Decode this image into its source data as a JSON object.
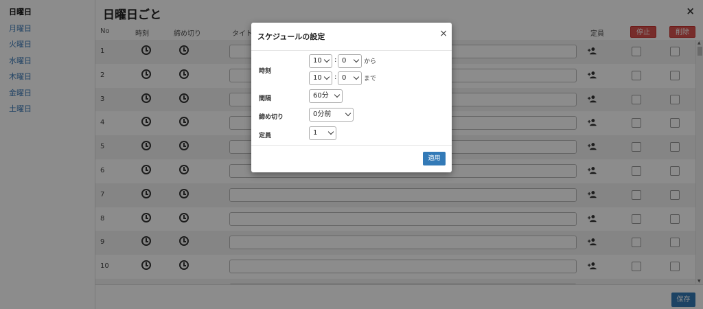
{
  "sidebar": {
    "items": [
      {
        "label": "日曜日"
      },
      {
        "label": "月曜日"
      },
      {
        "label": "火曜日"
      },
      {
        "label": "水曜日"
      },
      {
        "label": "木曜日"
      },
      {
        "label": "金曜日"
      },
      {
        "label": "土曜日"
      }
    ]
  },
  "main": {
    "title": "日曜日ごと",
    "close_icon": "×",
    "headers": {
      "no": "No",
      "time": "時刻",
      "deadline": "締め切り",
      "title": "タイト",
      "capacity": "定員",
      "stop": "停止",
      "delete": "削除"
    },
    "rows": [
      {
        "no": "1"
      },
      {
        "no": "2"
      },
      {
        "no": "3"
      },
      {
        "no": "4"
      },
      {
        "no": "5"
      },
      {
        "no": "6"
      },
      {
        "no": "7"
      },
      {
        "no": "8"
      },
      {
        "no": "9"
      },
      {
        "no": "10"
      }
    ],
    "save_label": "保存"
  },
  "modal": {
    "title": "スケジュールの設定",
    "close_icon": "×",
    "time_label": "時刻",
    "from_hour": "10",
    "from_minute": "0",
    "from_suffix": "から",
    "to_hour": "10",
    "to_minute": "0",
    "to_suffix": "まで",
    "colon": ":",
    "interval_label": "間隔",
    "interval_value": "60分",
    "deadline_label": "締め切り",
    "deadline_value": "0分前",
    "capacity_label": "定員",
    "capacity_value": "1",
    "apply_label": "適用"
  },
  "colors": {
    "accent": "#337ab7",
    "danger": "#d9534f",
    "link": "#3d7ab8"
  }
}
